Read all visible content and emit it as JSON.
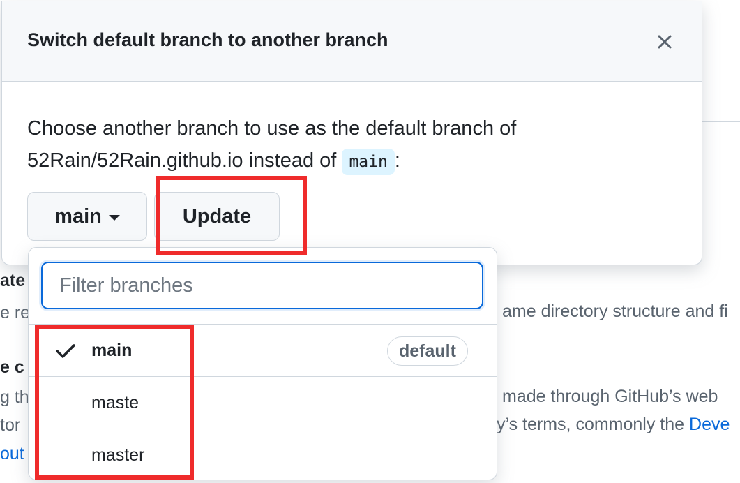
{
  "dialog": {
    "title": "Switch default branch to another branch",
    "description_prefix": "Choose another branch to use as the default branch of 52Rain/52Rain.github.io instead of ",
    "current_branch_code": "main",
    "description_suffix": ":",
    "branch_button_label": "main",
    "update_button_label": "Update",
    "close_icon": "close-icon"
  },
  "branch_menu": {
    "filter_placeholder": "Filter branches",
    "filter_value": "",
    "items": [
      {
        "label": "main",
        "selected": true,
        "badge": "default"
      },
      {
        "label": "maste",
        "selected": false,
        "badge": ""
      },
      {
        "label": "master",
        "selected": false,
        "badge": ""
      }
    ]
  },
  "background": {
    "line1_left": "ate",
    "line2_left": "e re",
    "line2_right": "ame directory structure and fi",
    "line3_left": "e c",
    "line4_left": "g th",
    "line4_right": "made through GitHub’s web",
    "line5_left": "tor",
    "line5_right": "y’s terms, commonly the ",
    "line5_link": "Deve",
    "line6_left": "out"
  },
  "colors": {
    "accent": "#0969da",
    "highlight": "#ef2b2b",
    "chip_bg": "#ddf4ff"
  }
}
